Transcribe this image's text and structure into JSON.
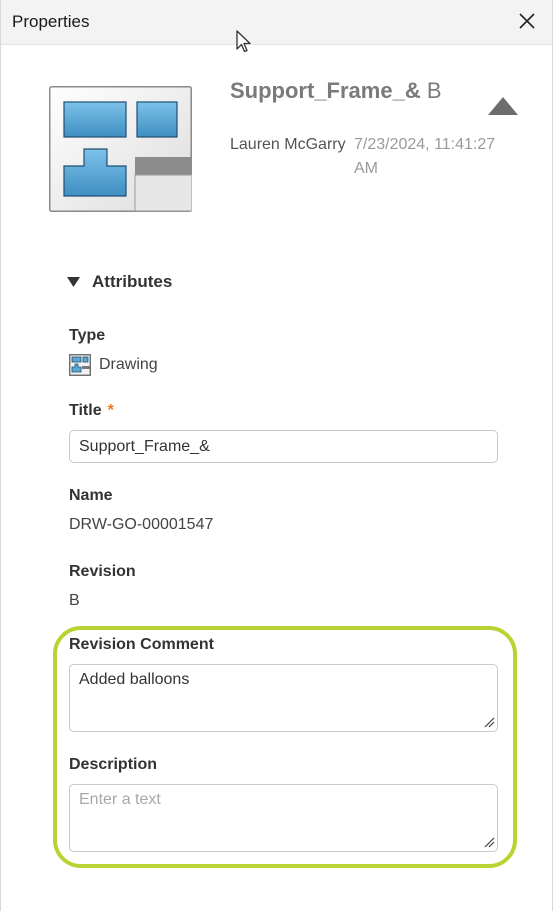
{
  "window": {
    "title": "Properties",
    "close_icon": "close-icon"
  },
  "header": {
    "name": "Support_Frame_&",
    "revision": "B",
    "author": "Lauren McGarry",
    "date_line1": "7/23/2024, 11:41:27",
    "date_line2": "AM",
    "collapse_icon": "triangle-up-icon",
    "thumbnail_icon": "drawing-thumbnail"
  },
  "attributes": {
    "section_title": "Attributes",
    "type_label": "Type",
    "type_value": "Drawing",
    "type_icon": "drawing-icon",
    "title_label": "Title",
    "title_required_mark": "*",
    "title_value": "Support_Frame_&",
    "name_label": "Name",
    "name_value": "DRW-GO-00001547",
    "revision_label": "Revision",
    "revision_value": "B",
    "revision_comment_label": "Revision Comment",
    "revision_comment_value": "Added balloons",
    "description_label": "Description",
    "description_placeholder": "Enter a text"
  },
  "colors": {
    "highlight": "#b7d433",
    "required": "#e8792a",
    "thumbnail_blue": "#5ba7d4"
  }
}
